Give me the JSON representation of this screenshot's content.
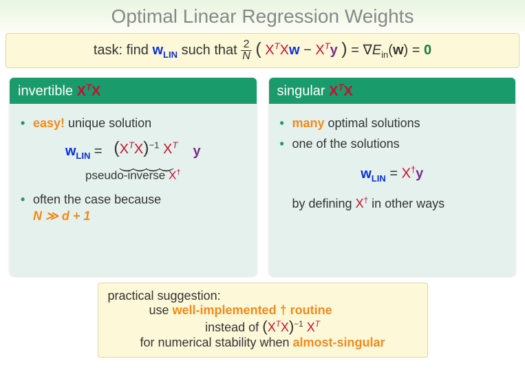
{
  "title": "Optimal Linear Regression Weights",
  "task": {
    "prefix": "task: find ",
    "w": "w",
    "w_sub": "LIN",
    "mid": " such that ",
    "frac_top": "2",
    "frac_bot": "N",
    "lparen": "(",
    "XtXw": {
      "X1": "X",
      "t": "T",
      "X2": "X",
      "w": "w"
    },
    "minus": " − ",
    "Xty": {
      "X": "X",
      "t": "T",
      "y": "y"
    },
    "rparen": ")",
    "eq1": " = ",
    "grad": "∇",
    "E": "E",
    "E_sub": "in",
    "w2": "w",
    "eq2": " = ",
    "zero": "0"
  },
  "left": {
    "header_pre": "invertible ",
    "XtX": {
      "X1": "X",
      "t": "T",
      "X2": "X"
    },
    "b1_em": "easy!",
    "b1_tail": " unique solution",
    "formula": {
      "w": "w",
      "w_sub": "LIN",
      "eq": " = ",
      "lb": "(",
      "X1": "X",
      "t": "T",
      "X2": "X",
      "rb": ")",
      "inv": "−1",
      "X3": "X",
      "t2": "T",
      "y": "y"
    },
    "brace_label_pre": "pseudo-inverse ",
    "brace_X": "X",
    "brace_dag": "†",
    "b2_pre": "often the case because",
    "b2_math": {
      "N": "N",
      "gg": "≫",
      "d": "d",
      "plus": " + ",
      "one": "1"
    }
  },
  "right": {
    "header_pre": "singular ",
    "XtX": {
      "X1": "X",
      "t": "T",
      "X2": "X"
    },
    "b1_em": "many",
    "b1_tail": " optimal solutions",
    "b2": "one of the solutions",
    "formula": {
      "w": "w",
      "w_sub": "LIN",
      "eq": " = ",
      "X": "X",
      "dag": "†",
      "y": "y"
    },
    "b3_pre": "by defining ",
    "b3_X": "X",
    "b3_dag": "†",
    "b3_tail": " in other ways"
  },
  "sugg": {
    "l1": "practical suggestion:",
    "l2_pre": "use ",
    "l2_em1": "well-implemented ",
    "l2_dag": "†",
    "l2_em2": " routine",
    "l3_pre": "instead of ",
    "l3_math": {
      "lb": "(",
      "X1": "X",
      "t": "T",
      "X2": "X",
      "rb": ")",
      "inv": "−1",
      "X3": "X",
      "t2": "T"
    },
    "l4_pre": "for numerical stability when ",
    "l4_em": "almost-singular"
  }
}
